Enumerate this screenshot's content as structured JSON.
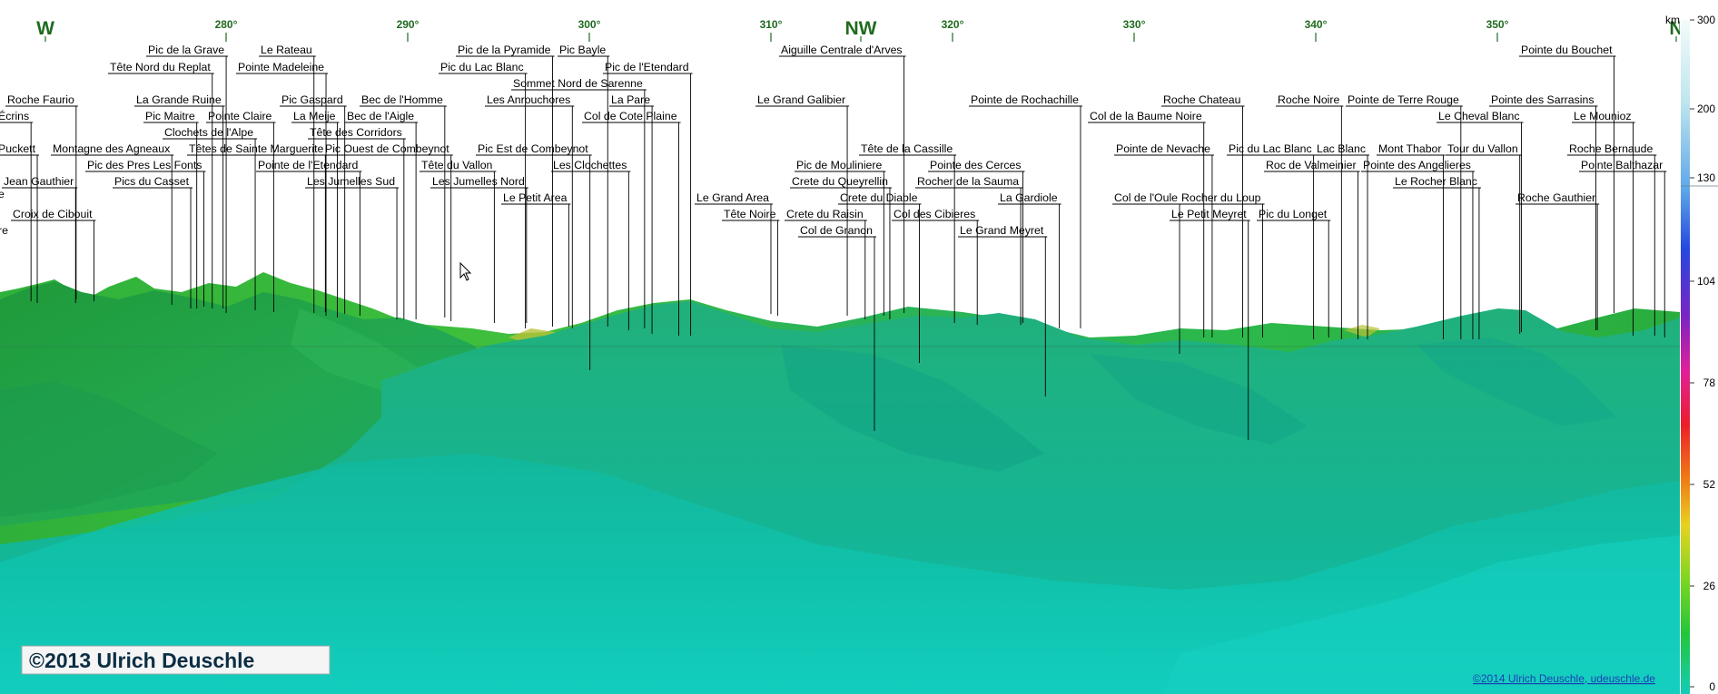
{
  "compass": [
    {
      "text": "W",
      "big": true
    },
    {
      "text": "280°"
    },
    {
      "text": "290°"
    },
    {
      "text": "300°"
    },
    {
      "text": "310°"
    },
    {
      "text": "NW",
      "big": true
    },
    {
      "text": "320°"
    },
    {
      "text": "330°"
    },
    {
      "text": "340°"
    },
    {
      "text": "350°"
    },
    {
      "text": "N",
      "big": true
    }
  ],
  "peaks": [
    "Pic de la Grave",
    "Le Rateau",
    "Tête Nord du Replat",
    "Pointe Madeleine",
    "Pic de la Pyramide",
    "Pic Bayle",
    "Pic du Lac Blanc",
    "Pic de l'Etendard",
    "Aiguille Centrale d'Arves",
    "Pointe du Bouchet",
    "Roche Faurio",
    "La Grande Ruine",
    "Pic Gaspard",
    "Bec de l'Homme",
    "Sommet Nord de Sarenne",
    "Les Anrouchores",
    "La Pare",
    "Le Grand Galibier",
    "Pointe de Rochachille",
    "Roche Chateau",
    "Roche Noire",
    "Pointe de Terre Rouge",
    "Pointe des Sarrasins",
    "Écrins",
    "Pic Maitre",
    "Pointe Claire",
    "La Meije",
    "Bec de l'Aigle",
    "Col de Cote Plaine",
    "Col de la Baume Noire",
    "Le Cheval Blanc",
    "Le Mounioz",
    "Clochets de l'Alpe",
    "Tête des Corridors",
    "Puckett",
    "Montagne des Agneaux",
    "Têtes de Sainte Marguerite",
    "Pic Ouest de Combeynot",
    "Pic Est de Combeynot",
    "Tête de la Cassille",
    "Pointe de Nevache",
    "Pic du Lac Blanc",
    "Lac Blanc",
    "Mont Thabor",
    "Tour du Vallon",
    "Roche Bernaude",
    "Pic des Pres Les Fonts",
    "Pointe de l'Etendard",
    "Tête du Vallon",
    "Les Clochettes",
    "Pic de Mouliniere",
    "Pointe des Cerces",
    "Roc de Valmeinier",
    "Pointe des Angelieres",
    "Pointe Balthazar",
    "Jean Gauthier",
    "Pics du Casset",
    "Les Jumelles Sud",
    "Les Jumelles Nord",
    "Crete du Queyrellin",
    "Rocher de la Sauma",
    "Le Rocher Blanc",
    "Le Petit Area",
    "Le Grand Area",
    "Crete du Diable",
    "La Gardiole",
    "Col de l'Oule",
    "Rocher du Loup",
    "Roche Gauthier",
    "Croix de Cibouit",
    "Tête Noire",
    "Crete du Raisin",
    "Col des Cibieres",
    "Le Petit Meyret",
    "Pic du Longet",
    "Col de Granon",
    "Le Grand Meyret"
  ],
  "edge_fragments": [
    "e",
    "re"
  ],
  "scale": {
    "unit": "km",
    "ticks": [
      "300",
      "200",
      "130",
      "104",
      "78",
      "52",
      "26",
      "0"
    ]
  },
  "copyright_left": "©2013 Ulrich Deuschle",
  "credit_link": "©2014 Ulrich Deuschle, udeuschle.de"
}
